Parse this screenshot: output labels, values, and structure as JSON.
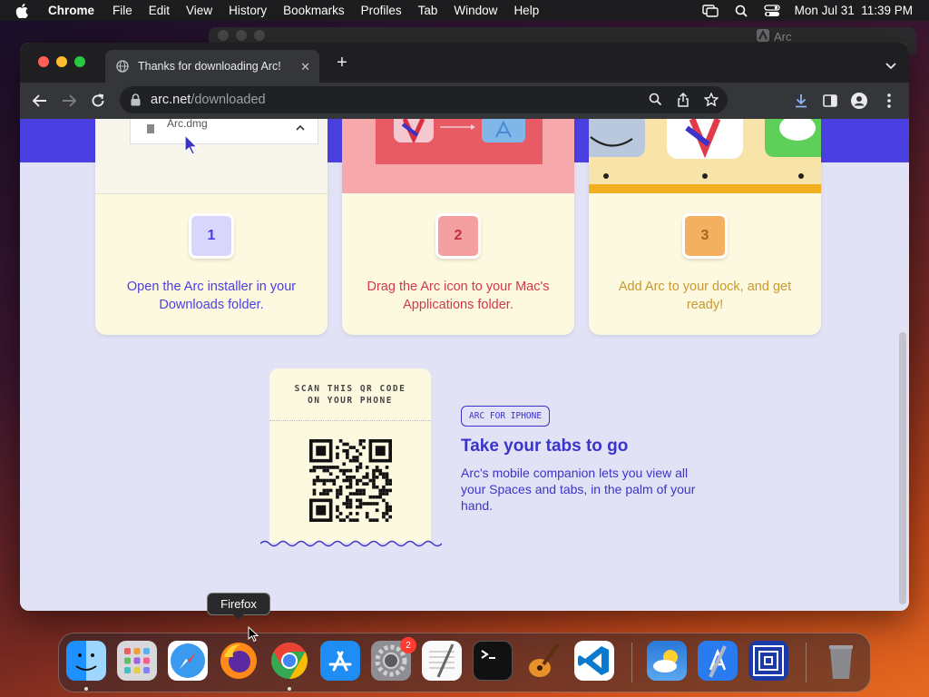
{
  "menubar": {
    "app": "Chrome",
    "items": [
      "File",
      "Edit",
      "View",
      "History",
      "Bookmarks",
      "Profiles",
      "Tab",
      "Window",
      "Help"
    ],
    "clock": "Mon Jul 31  11:39 PM"
  },
  "background_window": {
    "title": "Arc"
  },
  "browser": {
    "tab_title": "Thanks for downloading Arc!",
    "url_host": "arc.net",
    "url_path": "/downloaded"
  },
  "page": {
    "download_file": "Arc.dmg",
    "steps": [
      {
        "number": "1",
        "text": "Open the Arc installer in your Downloads folder.",
        "color": "#4a3fe0",
        "badge_bg": "#d8d6fb"
      },
      {
        "number": "2",
        "text": "Drag the Arc icon to your Mac's Applications folder.",
        "color": "#d23a4a",
        "badge_bg": "#f5a0a0"
      },
      {
        "number": "3",
        "text": "Add Arc to your dock, and get ready!",
        "color": "#c89a30",
        "badge_bg": "#f2b060"
      }
    ],
    "qr_title_line1": "SCAN THIS QR CODE",
    "qr_title_line2": "ON YOUR PHONE",
    "iphone_badge": "ARC FOR IPHONE",
    "iphone_heading": "Take your tabs to go",
    "iphone_desc": "Arc's mobile companion lets you view all your Spaces and tabs, in the palm of your hand."
  },
  "dock": {
    "tooltip": "Firefox",
    "apps": [
      "finder",
      "launchpad",
      "safari",
      "firefox",
      "chrome",
      "app-store",
      "system-settings",
      "textedit",
      "terminal",
      "garageband",
      "vscode",
      "weather",
      "xcode",
      "screen-app",
      "trash"
    ],
    "system_settings_badge": "2"
  },
  "colors": {
    "accent": "#3a34c8",
    "band": "#4a3fe0",
    "page_bg": "#e2e2f6"
  }
}
